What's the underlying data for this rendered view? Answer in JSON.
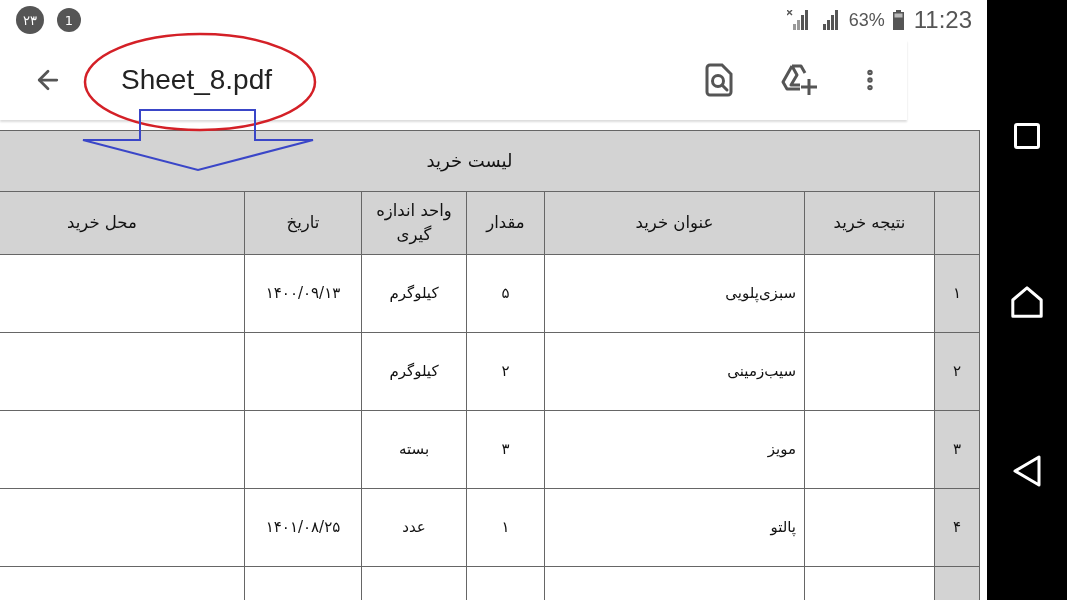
{
  "status_bar": {
    "notification_badge_1": "۲۳",
    "notification_badge_2": "1",
    "battery": "63%",
    "time": "11:23"
  },
  "app_bar": {
    "title": "Sheet_8.pdf"
  },
  "annotations": [
    {
      "kind": "ellipse"
    },
    {
      "kind": "arrow"
    }
  ],
  "table": {
    "title": "لیست خرید",
    "columns": [
      "نتیجه خرید",
      "عنوان خرید",
      "مقدار",
      "واحد اندازه گیری",
      "تاریخ",
      "محل خرید"
    ],
    "rows": [
      {
        "number": "۱",
        "item": "سبزی‌پلویی",
        "quantity": "۵",
        "unit": "کیلوگرم",
        "date": "۱۴۰۰/۰۹/۱۳"
      },
      {
        "number": "۲",
        "item": "سیب‌زمینی",
        "quantity": "۲",
        "unit": "کیلوگرم"
      },
      {
        "number": "۳",
        "item": "مویز",
        "quantity": "۳",
        "unit": "بسته"
      },
      {
        "number": "۴",
        "item": "پالتو",
        "quantity": "۱",
        "unit": "عدد",
        "date": "۱۴۰۱/۰۸/۲۵"
      }
    ]
  }
}
